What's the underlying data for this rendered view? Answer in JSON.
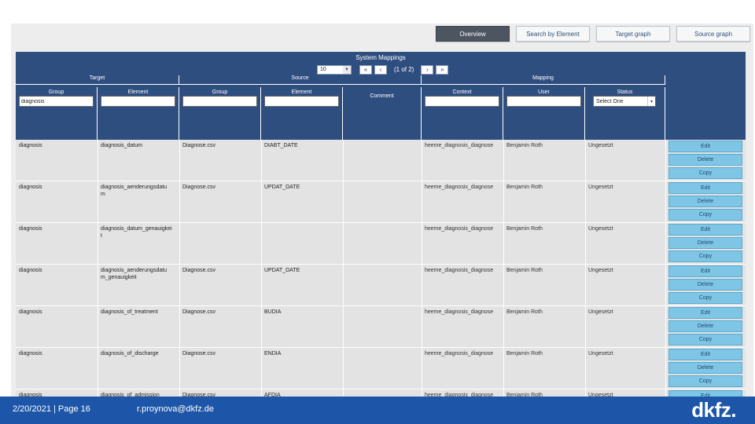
{
  "nav": {
    "tabs": [
      {
        "label": "Overview",
        "active": true
      },
      {
        "label": "Search by Element",
        "active": false
      },
      {
        "label": "Target graph",
        "active": false
      },
      {
        "label": "Source graph",
        "active": false
      }
    ]
  },
  "panel": {
    "title": "System Mappings",
    "pager": {
      "page_size": "10",
      "first": "«",
      "prev": "‹",
      "info": "(1 of 2)",
      "next": "›",
      "last": "»"
    },
    "group_headers": {
      "target": "Target",
      "source": "Source",
      "mapping": "Mapping"
    },
    "columns": {
      "target_group": "Group",
      "target_element": "Element",
      "source_group": "Group",
      "source_element": "Element",
      "comment": "Comment",
      "context": "Context",
      "user": "User",
      "status": "Status"
    },
    "filters": {
      "target_group_value": "diagnosis",
      "status_value": "Select One",
      "status_caret": "▾"
    }
  },
  "rows": [
    {
      "tgt_group": "diagnosis",
      "tgt_element": "diagnosis_datum",
      "src_group": "Diagnose.csv",
      "src_element": "DIABT_DATE",
      "context": "heeme_diagnosis_diagnose",
      "user": "Benjamin Roth",
      "status": "Ungesetzt"
    },
    {
      "tgt_group": "diagnosis",
      "tgt_element": "diagnosis_aenderungsdatu\nm",
      "src_group": "Diagnose.csv",
      "src_element": "UPDAT_DATE",
      "context": "heeme_diagnosis_diagnose",
      "user": "Benjamin Roth",
      "status": "Ungesetzt"
    },
    {
      "tgt_group": "diagnosis",
      "tgt_element": "diagnosis_datum_genauigkei\nt",
      "src_group": "",
      "src_element": "",
      "context": "heeme_diagnosis_diagnose",
      "user": "Benjamin Roth",
      "status": "Ungesetzt"
    },
    {
      "tgt_group": "diagnosis",
      "tgt_element": "diagnosis_aenderungsdatu\nm_genauigkeit",
      "src_group": "Diagnose.csv",
      "src_element": "UPDAT_DATE",
      "context": "heeme_diagnosis_diagnose",
      "user": "Benjamin Roth",
      "status": "Ungesetzt"
    },
    {
      "tgt_group": "diagnosis",
      "tgt_element": "diagnosis_of_treatment",
      "src_group": "Diagnose.csv",
      "src_element": "BUDIA",
      "context": "heeme_diagnosis_diagnose",
      "user": "Benjamin Roth",
      "status": "Ungesetzt"
    },
    {
      "tgt_group": "diagnosis",
      "tgt_element": "diagnosis_of_discharge",
      "src_group": "Diagnose.csv",
      "src_element": "ENDIA",
      "context": "heeme_diagnosis_diagnose",
      "user": "Benjamin Roth",
      "status": "Ungesetzt"
    },
    {
      "tgt_group": "diagnosis",
      "tgt_element": "diagnosis_of_admission",
      "src_group": "Diagnose.csv",
      "src_element": "AFDIA",
      "context": "heeme_diagnosis_diagnose",
      "user": "Benjamin Roth",
      "status": "Ungesetzt"
    }
  ],
  "row_actions": {
    "edit": "Edit",
    "delete": "Delete",
    "copy": "Copy"
  },
  "footer": {
    "date_page": "2/20/2021 | Page 16",
    "email": "r.proynova@dkfz.de",
    "logo": "dkfz."
  },
  "colors": {
    "header_blue": "#2f4e80",
    "footer_blue": "#1d56a8",
    "button_light_blue": "#7fc6e6"
  }
}
